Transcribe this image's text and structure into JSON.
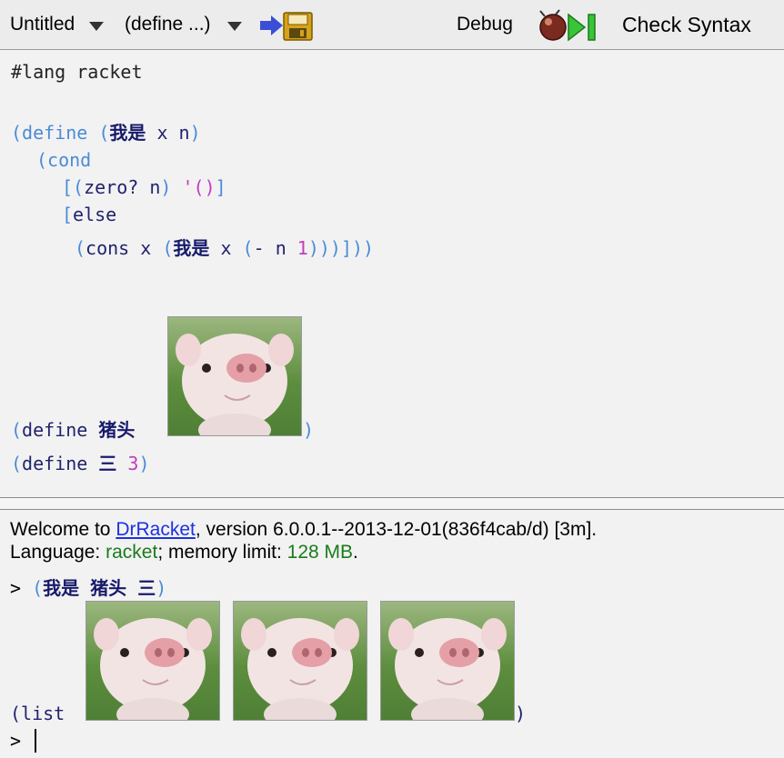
{
  "toolbar": {
    "file_name": "Untitled",
    "define_menu": "(define ...)",
    "debug_label": "Debug",
    "check_syntax_label": "Check Syntax"
  },
  "editor": {
    "lang_line": "#lang racket",
    "define_kw": "(define",
    "fn_name": "我是",
    "param_x": "x",
    "param_n": "n",
    "cond_kw": "(cond",
    "zero_q": "(zero?",
    "empty_list": "'()",
    "else_kw": "[else",
    "cons_kw": "(cons",
    "minus": "(-",
    "one": "1",
    "var_pig": "猪头",
    "var_three": "三",
    "three": "3"
  },
  "repl": {
    "welcome_prefix": "Welcome to",
    "welcome_link": "DrRacket",
    "welcome_suffix": ", version 6.0.0.1--2013-12-01(836f4cab/d) [3m].",
    "lang_prefix": "Language:",
    "lang_value": "racket",
    "mem_prefix": "; memory limit:",
    "mem_value": "128 MB",
    "mem_suffix": ".",
    "prompt": ">",
    "call_fn": "我是",
    "call_arg1": "猪头",
    "call_arg2": "三",
    "result_prefix": "(list",
    "result_close": ")"
  },
  "colors": {
    "paren": "#4b8bd6",
    "identifier": "#21236e",
    "number": "#c23cc2",
    "link": "#1c32e0",
    "green": "#1b7b1b"
  },
  "icons": [
    "chevron-down-icon",
    "arrow-right-icon",
    "save-icon",
    "bug-icon",
    "run-icon",
    "step-icon"
  ]
}
